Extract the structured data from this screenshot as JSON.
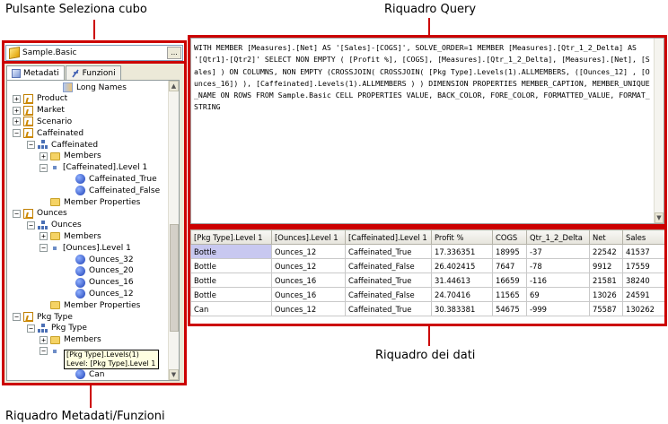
{
  "callouts": {
    "cube_button": "Pulsante Seleziona cubo",
    "query_pane": "Riquadro Query",
    "data_pane": "Riquadro dei dati",
    "metadata_pane": "Riquadro Metadati/Funzioni"
  },
  "cube_selector": {
    "value": "Sample.Basic",
    "button_label": "..."
  },
  "tabs": [
    {
      "label": "Metadati",
      "icon": "cube-icon"
    },
    {
      "label": "Funzioni",
      "icon": "function-icon"
    }
  ],
  "tree": [
    {
      "label": "Long Names",
      "icon": "long-names-icon",
      "expander": ""
    },
    {
      "label": "Product",
      "icon": "dimension-icon",
      "expander": "+"
    },
    {
      "label": "Market",
      "icon": "dimension-icon",
      "expander": "+"
    },
    {
      "label": "Scenario",
      "icon": "dimension-icon",
      "expander": "+"
    },
    {
      "label": "Caffeinated",
      "icon": "dimension-icon",
      "expander": "−"
    },
    {
      "label": "Caffeinated",
      "icon": "hierarchy-icon",
      "expander": "−"
    },
    {
      "label": "Members",
      "icon": "folder-icon",
      "expander": "+"
    },
    {
      "label": "[Caffeinated].Level 1",
      "icon": "level-icon",
      "expander": "−"
    },
    {
      "label": "Caffeinated_True",
      "icon": "member-icon",
      "expander": ""
    },
    {
      "label": "Caffeinated_False",
      "icon": "member-icon",
      "expander": ""
    },
    {
      "label": "Member Properties",
      "icon": "folder-icon",
      "expander": ""
    },
    {
      "label": "Ounces",
      "icon": "dimension-icon",
      "expander": "−"
    },
    {
      "label": "Ounces",
      "icon": "hierarchy-icon",
      "expander": "−"
    },
    {
      "label": "Members",
      "icon": "folder-icon",
      "expander": "+"
    },
    {
      "label": "[Ounces].Level 1",
      "icon": "level-icon",
      "expander": "−"
    },
    {
      "label": "Ounces_32",
      "icon": "member-icon",
      "expander": ""
    },
    {
      "label": "Ounces_20",
      "icon": "member-icon",
      "expander": ""
    },
    {
      "label": "Ounces_16",
      "icon": "member-icon",
      "expander": ""
    },
    {
      "label": "Ounces_12",
      "icon": "member-icon",
      "expander": ""
    },
    {
      "label": "Member Properties",
      "icon": "folder-icon",
      "expander": ""
    },
    {
      "label": "Pkg Type",
      "icon": "dimension-icon",
      "expander": "−"
    },
    {
      "label": "Pkg Type",
      "icon": "hierarchy-icon",
      "expander": "−"
    },
    {
      "label": "Members",
      "icon": "folder-icon",
      "expander": "+"
    },
    {
      "label": "",
      "icon": "level-icon",
      "expander": "−"
    },
    {
      "label": "",
      "icon": "",
      "expander": ""
    },
    {
      "label": "Can",
      "icon": "member-icon",
      "expander": ""
    }
  ],
  "tooltip": {
    "line1": "[Pkg Type].Levels(1)",
    "line2": "Level: [Pkg Type].Level 1"
  },
  "query": "WITH MEMBER [Measures].[Net] AS '[Sales]-[COGS]', SOLVE_ORDER=1 MEMBER [Measures].[Qtr_1_2_Delta] AS '[Qtr1]-[Qtr2]' SELECT NON EMPTY ( [Profit %], [COGS], [Measures].[Qtr_1_2_Delta], [Measures].[Net], [Sales] ) ON COLUMNS, NON EMPTY (CROSSJOIN( CROSSJOIN( [Pkg Type].Levels(1).ALLMEMBERS, ([Ounces_12] , [Ounces_16]) ), [Caffeinated].Levels(1).ALLMEMBERS ) ) DIMENSION PROPERTIES MEMBER_CAPTION, MEMBER_UNIQUE_NAME ON ROWS FROM Sample.Basic CELL PROPERTIES VALUE, BACK_COLOR, FORE_COLOR, FORMATTED_VALUE, FORMAT_STRING",
  "grid": {
    "headers": [
      "[Pkg Type].Level 1",
      "[Ounces].Level 1",
      "[Caffeinated].Level 1",
      "Profit %",
      "COGS",
      "Qtr_1_2_Delta",
      "Net",
      "Sales"
    ],
    "rows": [
      [
        "Bottle",
        "Ounces_12",
        "Caffeinated_True",
        "17.336351",
        "18995",
        "-37",
        "22542",
        "41537"
      ],
      [
        "Bottle",
        "Ounces_12",
        "Caffeinated_False",
        "26.402415",
        "7647",
        "-78",
        "9912",
        "17559"
      ],
      [
        "Bottle",
        "Ounces_16",
        "Caffeinated_True",
        "31.44613",
        "16659",
        "-116",
        "21581",
        "38240"
      ],
      [
        "Bottle",
        "Ounces_16",
        "Caffeinated_False",
        "24.70416",
        "11565",
        "69",
        "13026",
        "24591"
      ],
      [
        "Can",
        "Ounces_12",
        "Caffeinated_True",
        "30.383381",
        "54675",
        "-999",
        "75587",
        "130262"
      ]
    ]
  },
  "colors": {
    "callout_red": "#cc0000",
    "selection": "#c8c8f0"
  }
}
